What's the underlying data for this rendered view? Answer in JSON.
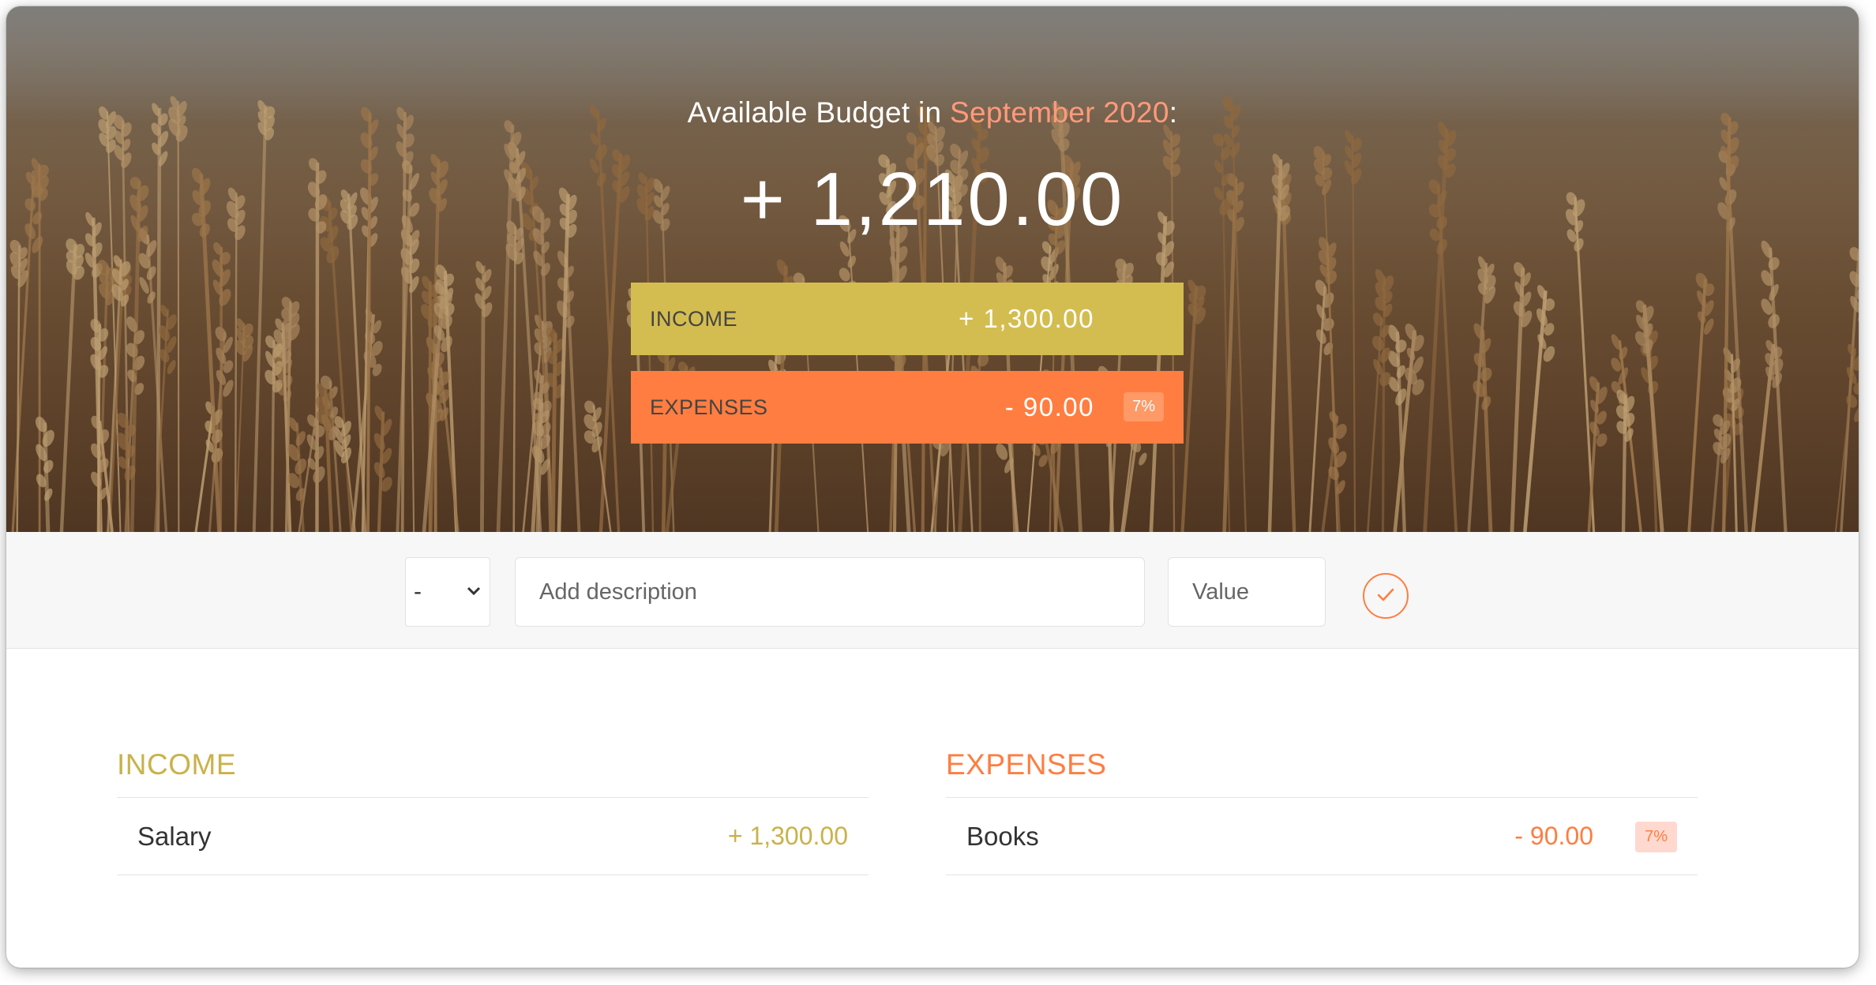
{
  "header": {
    "title_prefix": "Available Budget in",
    "month": "September 2020",
    "title_suffix": ":",
    "budget_value": "+ 1,210.00"
  },
  "summary": {
    "income_label": "INCOME",
    "income_value": "+ 1,300.00",
    "expenses_label": "EXPENSES",
    "expenses_value": "- 90.00",
    "expenses_percentage": "7%"
  },
  "add_form": {
    "type_selected": "-",
    "type_options": [
      "+",
      "-"
    ],
    "description_placeholder": "Add description",
    "value_placeholder": "Value",
    "submit_icon": "checkmark-circle-icon"
  },
  "income": {
    "title": "INCOME",
    "items": [
      {
        "description": "Salary",
        "value": "+ 1,300.00"
      }
    ]
  },
  "expenses": {
    "title": "EXPENSES",
    "items": [
      {
        "description": "Books",
        "value": "- 90.00",
        "percentage": "7%"
      }
    ]
  },
  "colors": {
    "income_accent": "#d4bd50",
    "expenses_accent": "#ff7d40",
    "month_highlight": "#ff9a7a"
  }
}
